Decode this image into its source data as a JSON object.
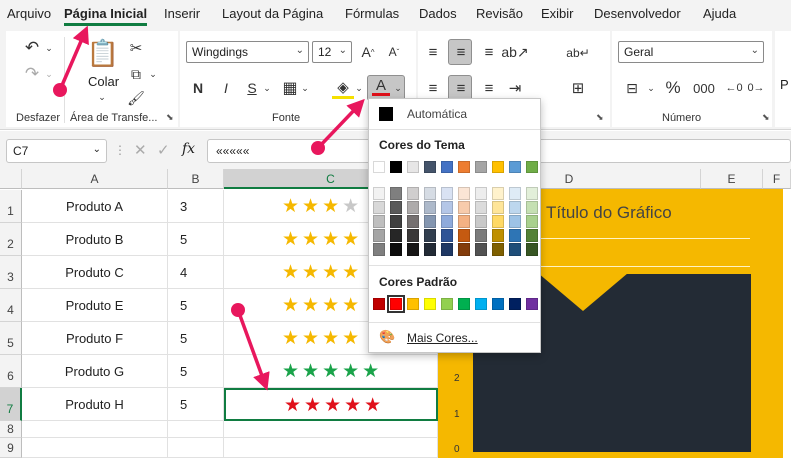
{
  "menu": [
    "Arquivo",
    "Página Inicial",
    "Inserir",
    "Layout da Página",
    "Fórmulas",
    "Dados",
    "Revisão",
    "Exibir",
    "Desenvolvedor",
    "Ajuda"
  ],
  "ribbon": {
    "undo_group": "Desfazer",
    "clipboard_group": "Área de Transfe...",
    "paste_label": "Colar",
    "font_group": "Fonte",
    "font_name": "Wingdings",
    "font_size": "12",
    "bold": "N",
    "italic": "I",
    "underline": "S",
    "number_format": "Geral",
    "number_group": "Número",
    "percent": "%",
    "thousands": "000",
    "styles_partial": "P"
  },
  "formula_bar": {
    "name_box": "C7",
    "fx": "fx",
    "formula": "«««««"
  },
  "columns": [
    "A",
    "B",
    "C",
    "D",
    "E",
    "F"
  ],
  "rows": [
    "1",
    "2",
    "3",
    "4",
    "5",
    "6",
    "7",
    "8",
    "9"
  ],
  "table": [
    {
      "product": "Produto A",
      "rating": "3",
      "stars_gold": 3,
      "stars_gray": 1,
      "star_color": "#f5b800"
    },
    {
      "product": "Produto B",
      "rating": "5",
      "stars_gold": 4,
      "stars_gray": 0,
      "star_color": "#f5b800"
    },
    {
      "product": "Produto C",
      "rating": "4",
      "stars_gold": 4,
      "stars_gray": 0,
      "star_color": "#f5b800"
    },
    {
      "product": "Produto E",
      "rating": "5",
      "stars_gold": 4,
      "stars_gray": 0,
      "star_color": "#f5b800"
    },
    {
      "product": "Produto F",
      "rating": "5",
      "stars_gold": 4,
      "stars_gray": 0,
      "star_color": "#f5b800"
    },
    {
      "product": "Produto G",
      "rating": "5",
      "stars_gold": 5,
      "stars_gray": 0,
      "star_color": "#1aa34a"
    },
    {
      "product": "Produto H",
      "rating": "5",
      "stars_gold": 5,
      "stars_gray": 0,
      "star_color": "#e0101a"
    }
  ],
  "chart": {
    "title": "Título do Gráfico",
    "y_ticks": [
      "2",
      "1",
      "0"
    ],
    "background": "#f5b800",
    "plot_color": "#232b35"
  },
  "color_dropdown": {
    "automatic": "Automática",
    "theme_colors": "Cores do Tema",
    "standard_colors": "Cores Padrão",
    "more_colors": "Mais Cores...",
    "theme_top": [
      "#ffffff",
      "#000000",
      "#e7e6e6",
      "#44546a",
      "#4472c4",
      "#ed7d31",
      "#a5a5a5",
      "#ffc000",
      "#5b9bd5",
      "#70ad47"
    ],
    "theme_shades": [
      [
        "#f2f2f2",
        "#7f7f7f",
        "#d0cece",
        "#d6dce4",
        "#d9e2f3",
        "#fbe5d5",
        "#ededed",
        "#fff2cc",
        "#deebf6",
        "#e2efd9"
      ],
      [
        "#d8d8d8",
        "#595959",
        "#aeabab",
        "#adb9ca",
        "#b4c6e7",
        "#f7cbac",
        "#dbdbdb",
        "#fee599",
        "#bdd7ee",
        "#c5e0b3"
      ],
      [
        "#bfbfbf",
        "#3f3f3f",
        "#757070",
        "#8496b0",
        "#8eaadb",
        "#f4b183",
        "#c9c9c9",
        "#ffd965",
        "#9dc3e6",
        "#a8d08d"
      ],
      [
        "#a5a5a5",
        "#262626",
        "#3a3838",
        "#323f4f",
        "#2f5496",
        "#c55a11",
        "#7b7b7b",
        "#bf9000",
        "#2e75b5",
        "#538135"
      ],
      [
        "#7f7f7f",
        "#0c0c0c",
        "#171616",
        "#222a35",
        "#1f3864",
        "#833c0b",
        "#525252",
        "#7f6000",
        "#1e4e79",
        "#375623"
      ]
    ],
    "standard": [
      "#c00000",
      "#ff0000",
      "#ffc000",
      "#ffff00",
      "#92d050",
      "#00b050",
      "#00b0f0",
      "#0070c0",
      "#002060",
      "#7030a0"
    ]
  },
  "annotation_color": "#e8175d"
}
